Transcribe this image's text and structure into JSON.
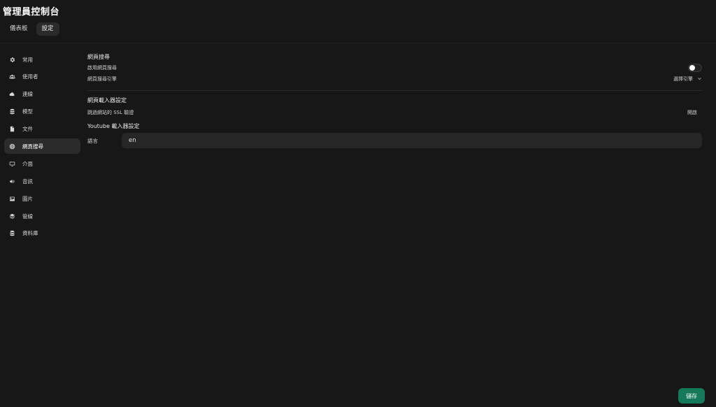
{
  "header": {
    "title": "管理員控制台",
    "tabs": [
      {
        "label": "儀表板",
        "active": false
      },
      {
        "label": "設定",
        "active": true
      }
    ]
  },
  "sidebar": {
    "items": [
      {
        "label": "常用",
        "icon": "gear-icon",
        "active": false
      },
      {
        "label": "使用者",
        "icon": "users-icon",
        "active": false
      },
      {
        "label": "連線",
        "icon": "cloud-icon",
        "active": false
      },
      {
        "label": "模型",
        "icon": "database-icon",
        "active": false
      },
      {
        "label": "文件",
        "icon": "document-icon",
        "active": false
      },
      {
        "label": "網頁搜尋",
        "icon": "globe-icon",
        "active": true
      },
      {
        "label": "介面",
        "icon": "monitor-icon",
        "active": false
      },
      {
        "label": "音訊",
        "icon": "speaker-icon",
        "active": false
      },
      {
        "label": "圖片",
        "icon": "image-icon",
        "active": false
      },
      {
        "label": "管線",
        "icon": "layers-icon",
        "active": false
      },
      {
        "label": "資料庫",
        "icon": "database-icon",
        "active": false
      }
    ]
  },
  "main": {
    "web_search": {
      "title": "網頁搜尋",
      "enable_label": "啟用網頁搜尋",
      "enabled": false,
      "engine_label": "網頁搜尋引擎",
      "engine_value": "選擇引擎"
    },
    "web_loader": {
      "title": "網頁載入器設定",
      "ssl_label": "跳過網站的 SSL 驗證",
      "ssl_value": "開啟"
    },
    "youtube_loader": {
      "title": "Youtube 載入器設定",
      "language_label": "語言",
      "language_value": "en"
    }
  },
  "footer": {
    "save_label": "儲存"
  },
  "colors": {
    "background": "#171717",
    "active_item": "#2b2b2b",
    "save_button": "#16795a"
  }
}
